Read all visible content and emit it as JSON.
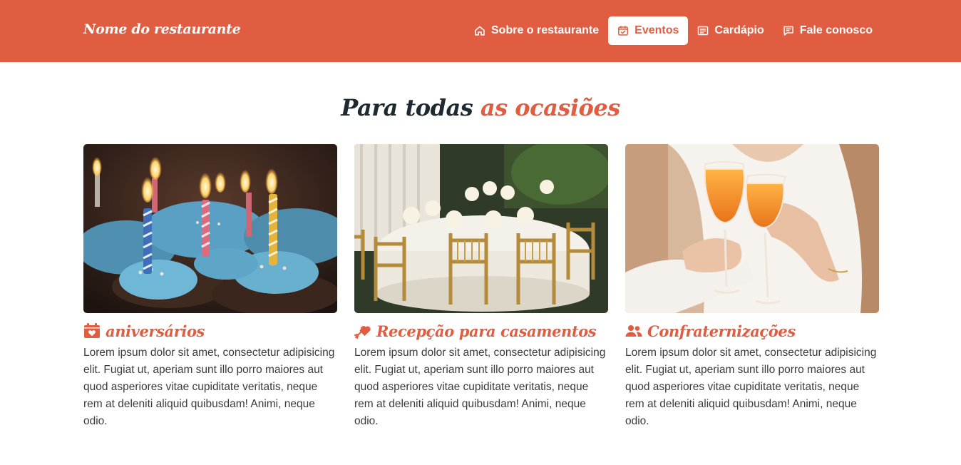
{
  "header": {
    "brand": "Nome do restaurante",
    "nav": [
      {
        "label": "Sobre o restaurante",
        "icon": "home-icon",
        "active": false
      },
      {
        "label": "Eventos",
        "icon": "calendar-check-icon",
        "active": true
      },
      {
        "label": "Cardápio",
        "icon": "menu-list-icon",
        "active": false
      },
      {
        "label": "Fale conosco",
        "icon": "chat-icon",
        "active": false
      }
    ]
  },
  "section": {
    "title_part1": "Para todas",
    "title_part2": "as ocasiões"
  },
  "cards": [
    {
      "title": "aniversários",
      "icon": "calendar-heart-icon",
      "image": "birthday-cupcakes-photo",
      "text": "Lorem ipsum dolor sit amet, consectetur adipisicing elit. Fugiat ut, aperiam sunt illo porro maiores aut quod asperiores vitae cupiditate veritatis, neque rem at deleniti aliquid quibusdam! Animi, neque odio."
    },
    {
      "title": "Recepção para casamentos",
      "icon": "cupid-arrow-icon",
      "image": "wedding-tables-photo",
      "text": "Lorem ipsum dolor sit amet, consectetur adipisicing elit. Fugiat ut, aperiam sunt illo porro maiores aut quod asperiores vitae cupiditate veritatis, neque rem at deleniti aliquid quibusdam! Animi, neque odio."
    },
    {
      "title": "Confraternizações",
      "icon": "users-icon",
      "image": "toast-glasses-photo",
      "text": "Lorem ipsum dolor sit amet, consectetur adipisicing elit. Fugiat ut, aperiam sunt illo porro maiores aut quod asperiores vitae cupiditate veritatis, neque rem at deleniti aliquid quibusdam! Animi, neque odio."
    }
  ],
  "colors": {
    "accent": "#e05d41",
    "heading_dark": "#1f2a30",
    "body_text": "#3a3a3a",
    "background": "#ffffff"
  }
}
